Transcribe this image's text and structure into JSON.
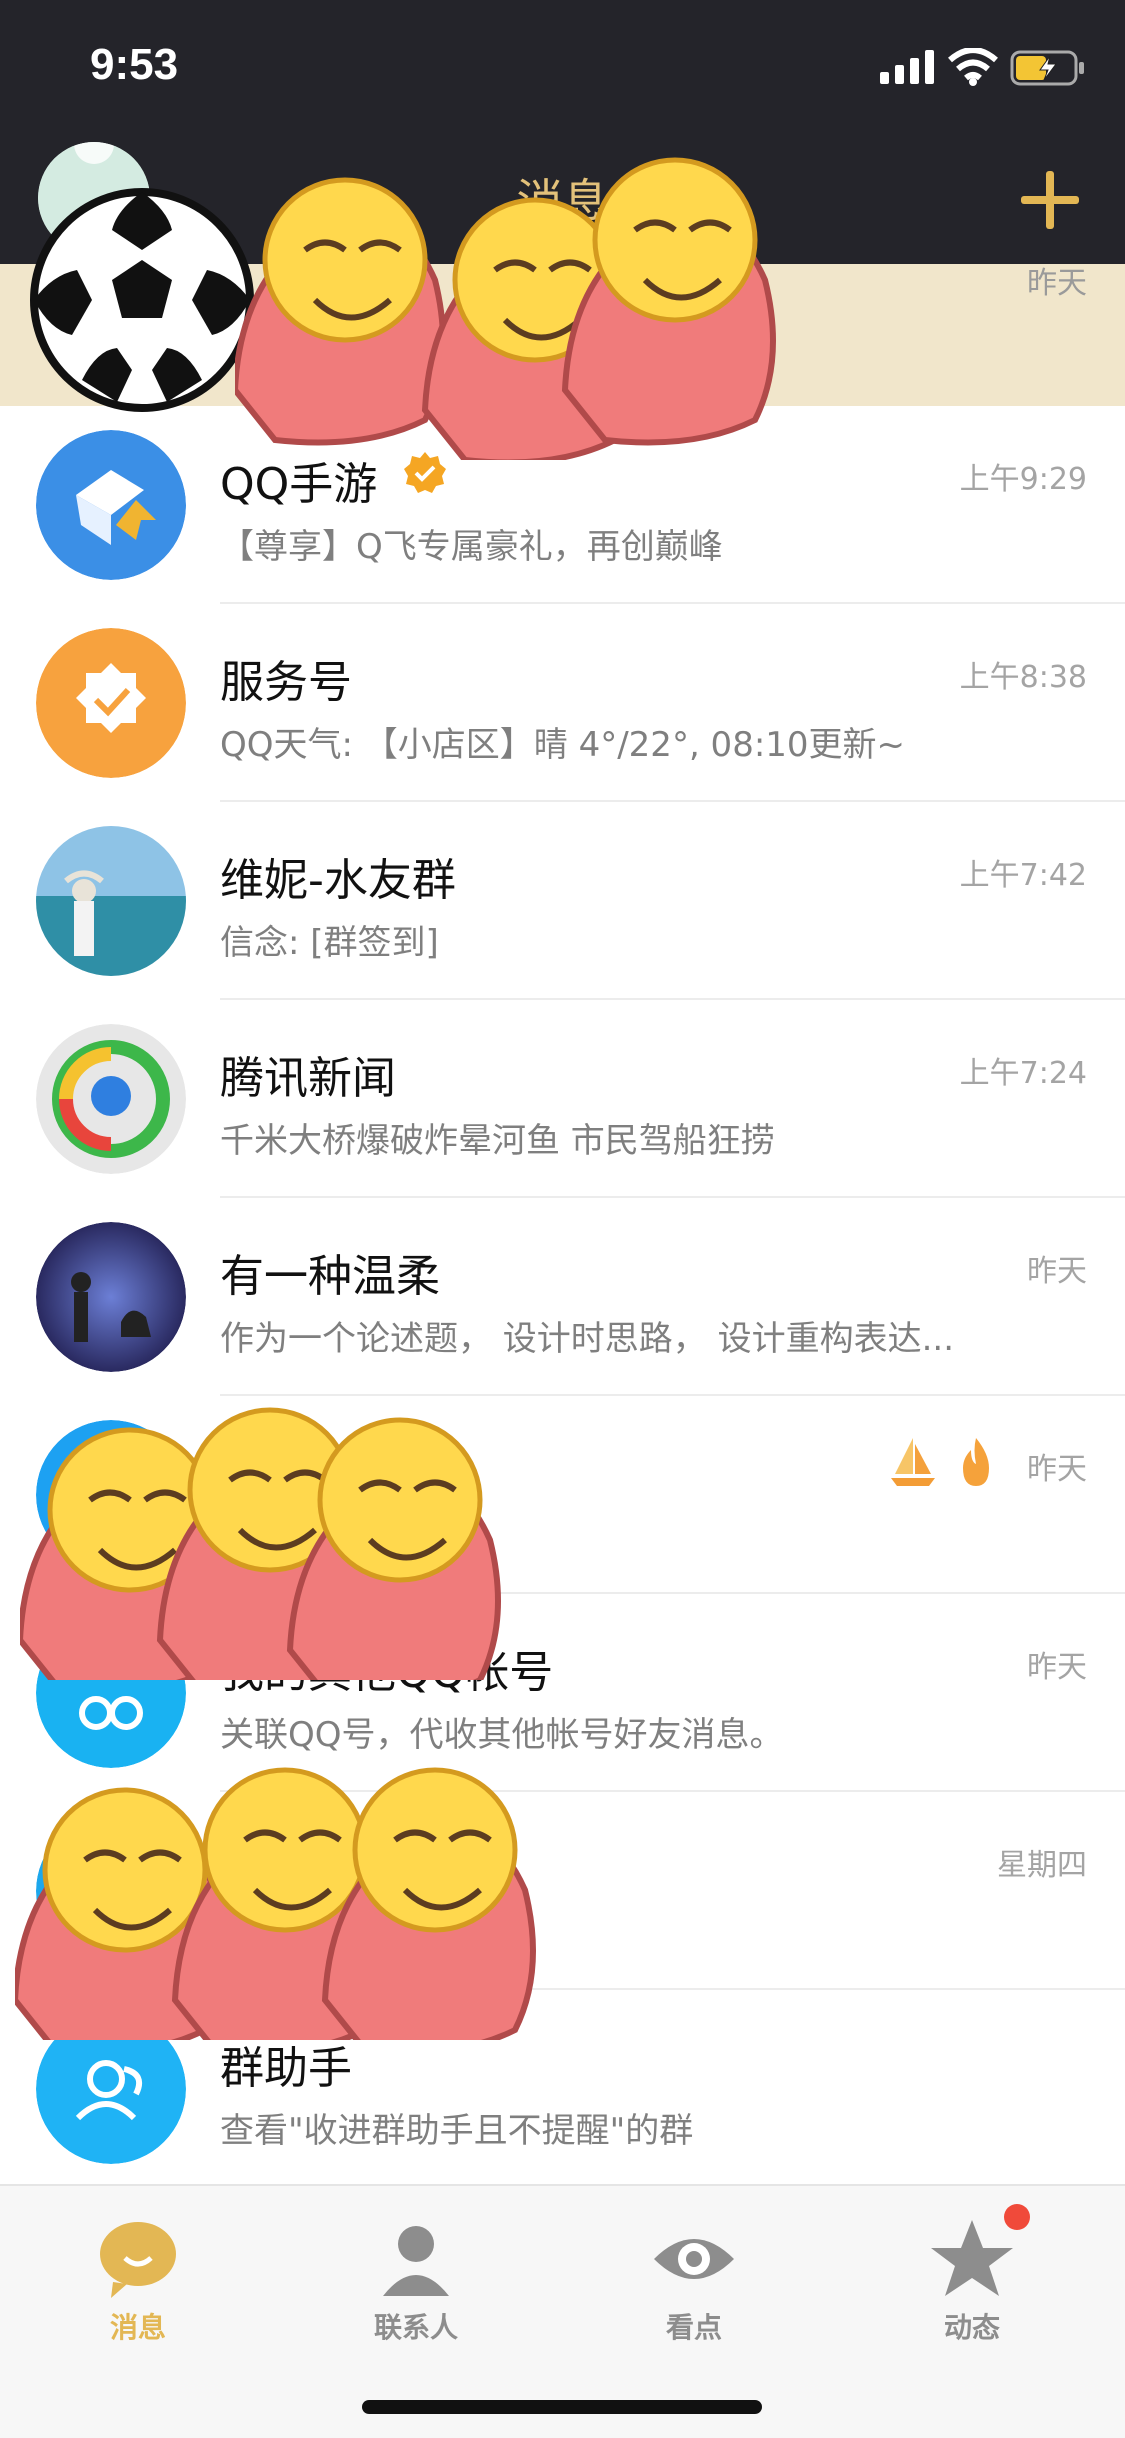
{
  "status_bar": {
    "time": "9:53"
  },
  "header": {
    "title": "消息"
  },
  "pinned": {
    "time": "昨天"
  },
  "conversations": [
    {
      "title": "QQ手游",
      "subtitle": "【尊享】Q飞专属豪礼，再创巅峰",
      "time": "上午9:29"
    },
    {
      "title": "服务号",
      "subtitle": "QQ天气: 【小店区】晴 4°/22°, 08:10更新~",
      "time": "上午8:38"
    },
    {
      "title": "维妮-水友群",
      "subtitle": "信念: [群签到]",
      "time": "上午7:42"
    },
    {
      "title": "腾讯新闻",
      "subtitle": "千米大桥爆破炸晕河鱼 市民驾船狂捞",
      "time": "上午7:24"
    },
    {
      "title": "有一种温柔",
      "subtitle": "作为一个论述题， 设计时思路， 设计重构表达...",
      "time": "昨天"
    },
    {
      "title": "",
      "subtitle": "",
      "time": "昨天"
    },
    {
      "title": "我的其他QQ帐号",
      "subtitle": "关联QQ号，代收其他帐号好友消息。",
      "time": "昨天"
    },
    {
      "title": "",
      "subtitle": "",
      "time": "星期四"
    },
    {
      "title": "群助手",
      "subtitle": "查看\"收进群助手且不提醒\"的群",
      "time": ""
    }
  ],
  "tabs": [
    {
      "label": "消息",
      "color": "#e3b754"
    },
    {
      "label": "联系人",
      "color": "#8d8d8d"
    },
    {
      "label": "看点",
      "color": "#8d8d8d"
    },
    {
      "label": "动态",
      "color": "#8d8d8d"
    }
  ],
  "colors": {
    "accent": "#e3b754",
    "header_bg": "#24242a",
    "pinned_bg": "#f1e6cb",
    "badge": "#f04a3a"
  }
}
